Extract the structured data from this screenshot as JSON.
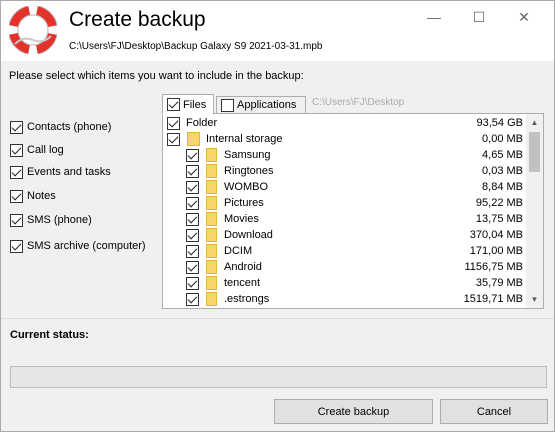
{
  "header": {
    "title": "Create backup",
    "path": "C:\\Users\\FJ\\Desktop\\Backup Galaxy S9 2021-03-31.mpb"
  },
  "window_controls": {
    "minimize": "—",
    "maximize": "☐",
    "close": "✕"
  },
  "instructions": "Please select which items you want to include in the backup:",
  "checklist": [
    {
      "label": "Contacts (phone)",
      "checked": true
    },
    {
      "label": "Call log",
      "checked": true
    },
    {
      "label": "Events and tasks",
      "checked": true
    },
    {
      "label": "Notes",
      "checked": true
    },
    {
      "label": "SMS (phone)",
      "checked": true
    },
    {
      "label": "SMS archive (computer)",
      "checked": true
    }
  ],
  "tabs": [
    {
      "label": "Files",
      "checked": true,
      "active": true
    },
    {
      "label": "Applications",
      "checked": false,
      "active": false
    }
  ],
  "tab_path": "C:\\Users\\FJ\\Desktop",
  "tree": {
    "root": {
      "name": "Folder",
      "size": "93,54 GB",
      "checked": true
    },
    "storage": {
      "name": "Internal storage",
      "size": "0,00  MB",
      "checked": true
    },
    "items": [
      {
        "name": "Samsung",
        "size": "4,65  MB",
        "checked": true
      },
      {
        "name": "Ringtones",
        "size": "0,03  MB",
        "checked": true
      },
      {
        "name": "WOMBO",
        "size": "8,84  MB",
        "checked": true
      },
      {
        "name": "Pictures",
        "size": "95,22  MB",
        "checked": true
      },
      {
        "name": "Movies",
        "size": "13,75  MB",
        "checked": true
      },
      {
        "name": "Download",
        "size": "370,04  MB",
        "checked": true
      },
      {
        "name": "DCIM",
        "size": "171,00  MB",
        "checked": true
      },
      {
        "name": "Android",
        "size": "1156,75  MB",
        "checked": true
      },
      {
        "name": "tencent",
        "size": "35,79  MB",
        "checked": true
      },
      {
        "name": ".estrongs",
        "size": "1519,71  MB",
        "checked": true
      }
    ]
  },
  "status": {
    "label": "Current status:",
    "progress": 0
  },
  "buttons": {
    "create": "Create backup",
    "cancel": "Cancel"
  },
  "colors": {
    "folder": "#f6d56b",
    "logo_red": "#e2322a",
    "progress_fill": "#06b025"
  },
  "icons": {
    "logo": "lifebuoy-icon",
    "folder": "folder-icon",
    "scroll_up": "chevron-up-icon",
    "scroll_down": "chevron-down-icon"
  }
}
